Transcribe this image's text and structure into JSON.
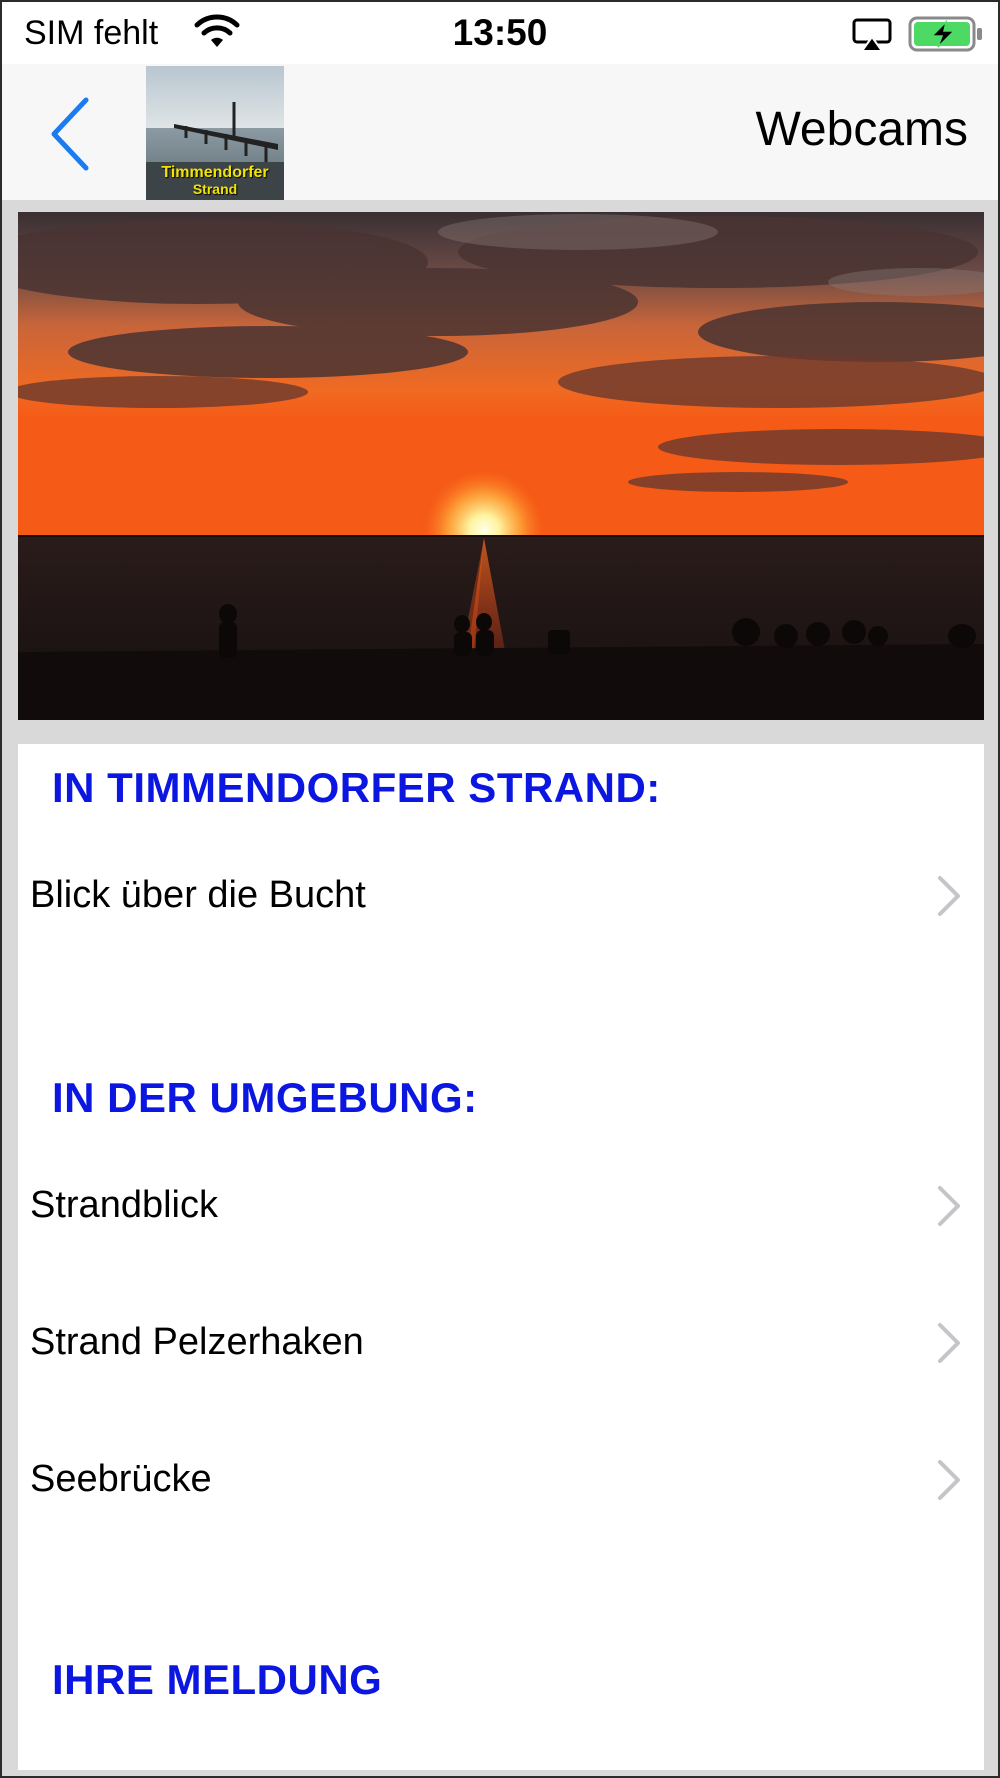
{
  "status_bar": {
    "carrier": "SIM fehlt",
    "time": "13:50"
  },
  "nav": {
    "title": "Webcams",
    "logo_line1": "Timmendorfer",
    "logo_line2": "Strand"
  },
  "sections": [
    {
      "header": "IN TIMMENDORFER STRAND:",
      "items": [
        "Blick über die Bucht"
      ]
    },
    {
      "header": "IN DER UMGEBUNG:",
      "items": [
        "Strandblick",
        "Strand Pelzerhaken",
        "Seebrücke"
      ]
    },
    {
      "header": "IHRE MELDUNG",
      "items": []
    }
  ],
  "colors": {
    "accent": "#1a7cf0",
    "section_header": "#0b16e0",
    "chevron": "#c4c4c9"
  },
  "icons": {
    "back": "chevron-left-icon",
    "row": "chevron-right-icon"
  }
}
